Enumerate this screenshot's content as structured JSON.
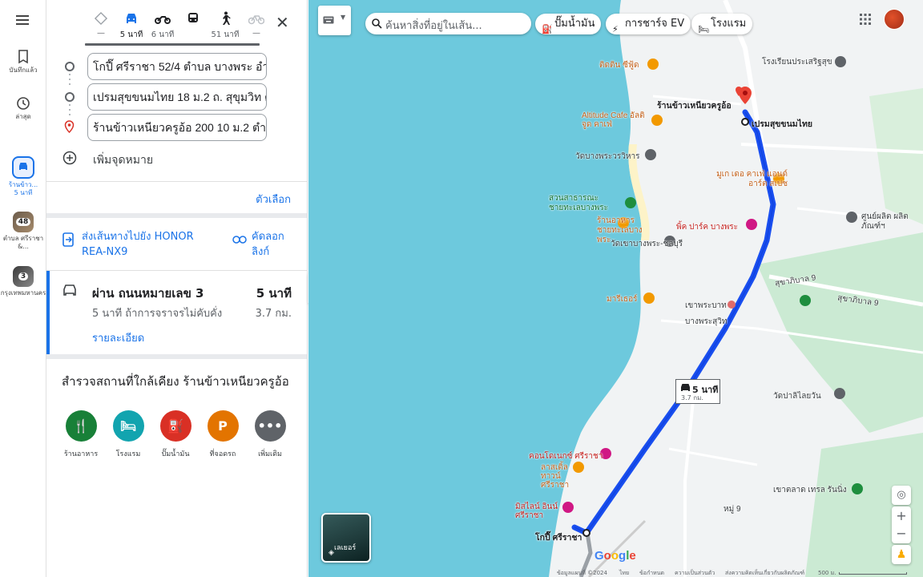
{
  "rail": {
    "saved_label": "บันทึกแล้ว",
    "recent_label": "ล่าสุด",
    "active_item_label": "ร้านข้าว...",
    "active_item_time": "5 นาที",
    "item2_badge": "48",
    "item2_label": "ตำบล ศรีราชา &...",
    "item3_badge": "3",
    "item3_label": "กรุงเทพมหานคร"
  },
  "modes": {
    "best": "—",
    "car": "5 นาที",
    "moto": "6 นาที",
    "transit": "",
    "walk": "51 นาที",
    "bike": "—"
  },
  "stops": {
    "origin": "โกปี๊ ศรีราชา 52/4 ตำบล บางพระ อำเภ",
    "waypoint": "เปรมสุขขนมไทย 18 ม.2 ถ. สุขุมวิท ตำ",
    "destination": "ร้านข้าวเหนียวครูอ้อ 200 10 ม.2 ตำบล",
    "add_destination": "เพิ่มจุดหมาย"
  },
  "options_label": "ตัวเลือก",
  "send": {
    "label": "ส่งเส้นทางไปยัง HONOR REA-NX9",
    "copy_label": "คัดลอกลิงก์"
  },
  "route": {
    "title": "ผ่าน ถนนหมายเลข 3",
    "time": "5 นาที",
    "subtitle": "5 นาที ถ้าการจราจรไม่คับคั่ง",
    "distance": "3.7 กม.",
    "details_label": "รายละเอียด"
  },
  "explore": {
    "title": "สำรวจสถานที่ใกล้เคียง ร้านข้าวเหนียวครูอ้อ",
    "items": [
      {
        "label": "ร้านอาหาร",
        "color": "#188038"
      },
      {
        "label": "โรงแรม",
        "color": "#12a4af"
      },
      {
        "label": "ปั๊มน้ำมัน",
        "color": "#d93025"
      },
      {
        "label": "ที่จอดรถ",
        "color": "#e37400"
      },
      {
        "label": "เพิ่มเติม",
        "color": "#5f6368"
      }
    ]
  },
  "map": {
    "search_placeholder": "ค้นหาสิ่งที่อยู่ในเส้น...",
    "chip_gas": "ปั๊มน้ำมัน",
    "chip_ev": "การชาร์จ EV",
    "chip_hotel": "โรงแรม",
    "layers_label": "เลเยอร์",
    "time_box_time": "5 นาที",
    "time_box_distance": "3.7 กม.",
    "google": "Google",
    "labels": {
      "school": "โรงเรียนประเสริฐสุข",
      "dest": "ร้านข้าวเหนียวครูอ้อ",
      "waypoint": "เปรมสุขขนมไทย",
      "origin": "โกปี๊ ศรีราชา",
      "tidtin": "ติดติน ซีฟู้ด",
      "altitude": "Altitude Cafe อัลติจูด คาเฟ่",
      "temple1": "วัดบางพระวรวิหาร",
      "mucafe": "มูเก เดอ คาเฟ่ แอนด์ อาร์ต สเปซ",
      "public_park": "สวนสาธารณะ ชายทะเลบางพระ",
      "seafood": "ร้านอาหาร ชายทะเลบางพระ",
      "pink_park": "พิ้ค ปาร์ค บางพระ",
      "temple2": "วัดเขาบางพระ-ชลบุรี",
      "center": "ศูนย์ผลิต ผลิตภัณฑ์ฯ",
      "sukhaphiban": "สุขาภิบาล 9",
      "sukhaphiban2": "สุขาภิบาล 9",
      "marine": "มารีเธอร์",
      "khaophra": "เขาพระบาท",
      "bangphra": "บางพระสุวิท",
      "temple3": "วัดปาลิไลยวัน",
      "condo": "คอนโดเนกซ์ ศรีราชา",
      "castle": "ลาสเติ้ล ทาวน์ ศรีราชา",
      "hotel": "มิสไลน์ อินน์ ศรีราชา",
      "khaotalad": "เขาตลาด เทรล รันนิ่ง",
      "moo9": "หมู่ 9"
    },
    "footer": {
      "data": "ข้อมูลแผนที่ ©2024",
      "lang": "ไทย",
      "terms": "ข้อกำหนด",
      "privacy": "ความเป็นส่วนตัว",
      "feedback": "ส่งความคิดเห็นเกี่ยวกับผลิตภัณฑ์",
      "scale": "500 ม."
    }
  },
  "colors": {
    "accent": "#1a73e8",
    "route": "#1a4ff0",
    "water": "#6dc9dd",
    "land": "#f1f3f4",
    "park": "#cbead3",
    "pin": "#ea4335"
  }
}
